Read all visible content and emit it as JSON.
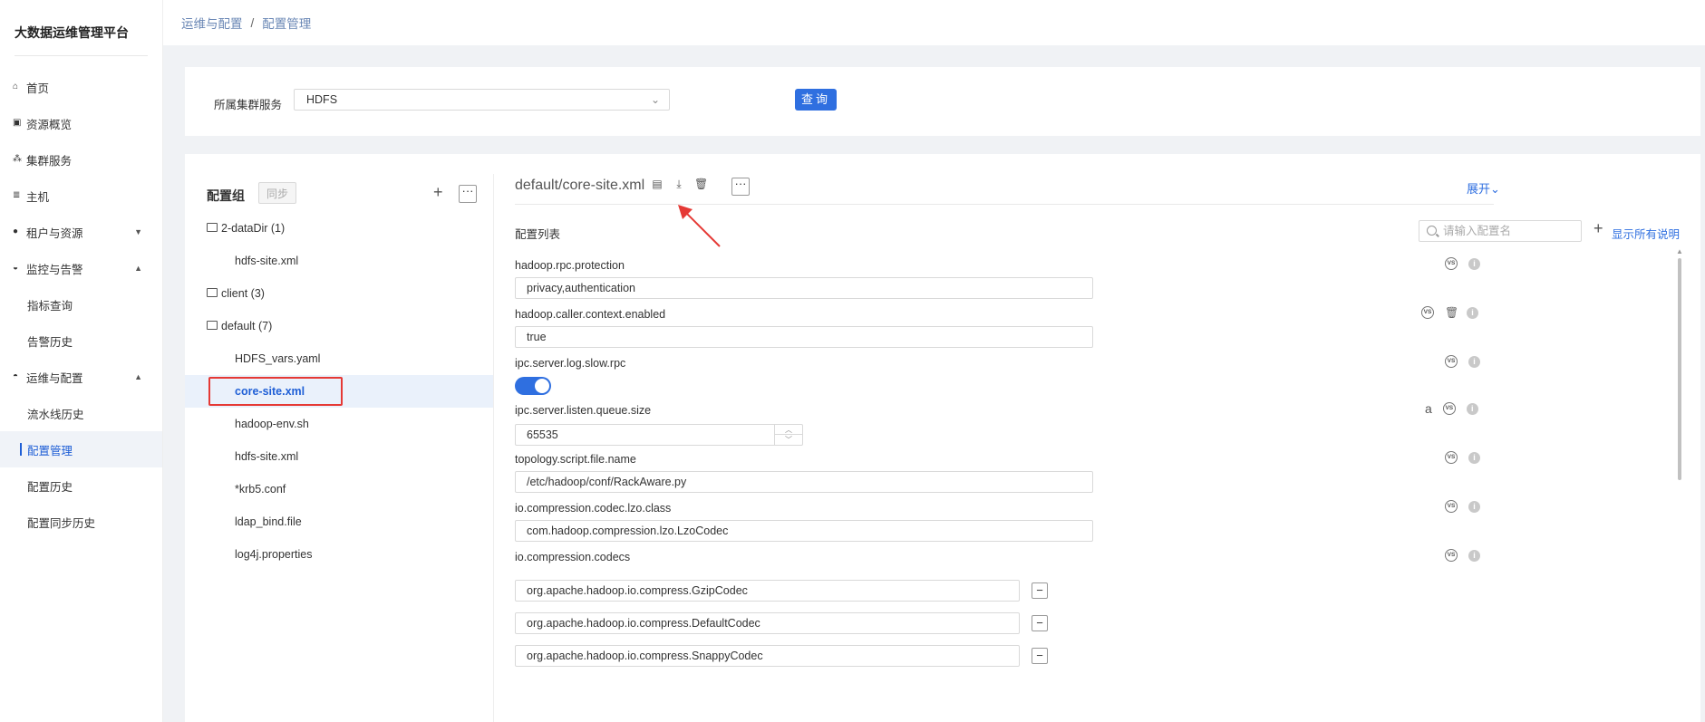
{
  "app": {
    "title": "大数据运维管理平台"
  },
  "sidebar": {
    "items": [
      {
        "label": "首页",
        "icon": "home-icon",
        "glyph": "⌂"
      },
      {
        "label": "资源概览",
        "icon": "monitor-icon",
        "glyph": "▣"
      },
      {
        "label": "集群服务",
        "icon": "cluster-icon",
        "glyph": "⁂"
      },
      {
        "label": "主机",
        "icon": "server-icon",
        "glyph": "≣"
      },
      {
        "label": "租户与资源",
        "icon": "tenant-icon",
        "glyph": "●",
        "arrow": "▼"
      },
      {
        "label": "监控与告警",
        "icon": "alarm-icon",
        "glyph": "◒",
        "arrow": "▲"
      },
      {
        "label": "指标查询"
      },
      {
        "label": "告警历史"
      },
      {
        "label": "运维与配置",
        "icon": "ops-icon",
        "glyph": "◓",
        "arrow": "▲"
      },
      {
        "label": "流水线历史"
      },
      {
        "label": "配置管理"
      },
      {
        "label": "配置历史"
      },
      {
        "label": "配置同步历史"
      }
    ]
  },
  "breadcrumb": {
    "parent": "运维与配置",
    "separator": "/",
    "current": "配置管理"
  },
  "filter": {
    "label": "所属集群服务",
    "selected": "HDFS",
    "query_button": "查询"
  },
  "config_group": {
    "title": "配置组",
    "sync_button": "同步",
    "tree": [
      {
        "type": "folder",
        "label": "2-dataDir (1)"
      },
      {
        "type": "file",
        "label": "hdfs-site.xml"
      },
      {
        "type": "folder",
        "label": "client (3)"
      },
      {
        "type": "folder",
        "label": "default (7)"
      },
      {
        "type": "file",
        "label": "HDFS_vars.yaml"
      },
      {
        "type": "file",
        "label": "core-site.xml",
        "selected": true
      },
      {
        "type": "file",
        "label": "hadoop-env.sh"
      },
      {
        "type": "file",
        "label": "hdfs-site.xml"
      },
      {
        "type": "file",
        "label": "*krb5.conf"
      },
      {
        "type": "file",
        "label": "ldap_bind.file"
      },
      {
        "type": "file",
        "label": "log4j.properties"
      }
    ]
  },
  "editor": {
    "file_title": "default/core-site.xml",
    "expand_link": "展开",
    "list_title": "配置列表",
    "search_placeholder": "请输入配置名",
    "show_all_link": "显示所有说明",
    "vs_label": "VS",
    "info_label": "i",
    "entries": [
      {
        "name": "hadoop.rpc.protection",
        "value": "privacy,authentication"
      },
      {
        "name": "hadoop.caller.context.enabled",
        "value": "true"
      },
      {
        "name": "ipc.server.log.slow.rpc",
        "toggle_on": true
      },
      {
        "name": "ipc.server.listen.queue.size",
        "value": "65535"
      },
      {
        "name": "topology.script.file.name",
        "value": "/etc/hadoop/conf/RackAware.py"
      },
      {
        "name": "io.compression.codec.lzo.class",
        "value": "com.hadoop.compression.lzo.LzoCodec"
      },
      {
        "name": "io.compression.codecs",
        "values": [
          "org.apache.hadoop.io.compress.GzipCodec",
          "org.apache.hadoop.io.compress.DefaultCodec",
          "org.apache.hadoop.io.compress.SnappyCodec"
        ]
      }
    ]
  },
  "colors": {
    "accent": "#2f6fe0",
    "annotation": "#e53935"
  }
}
